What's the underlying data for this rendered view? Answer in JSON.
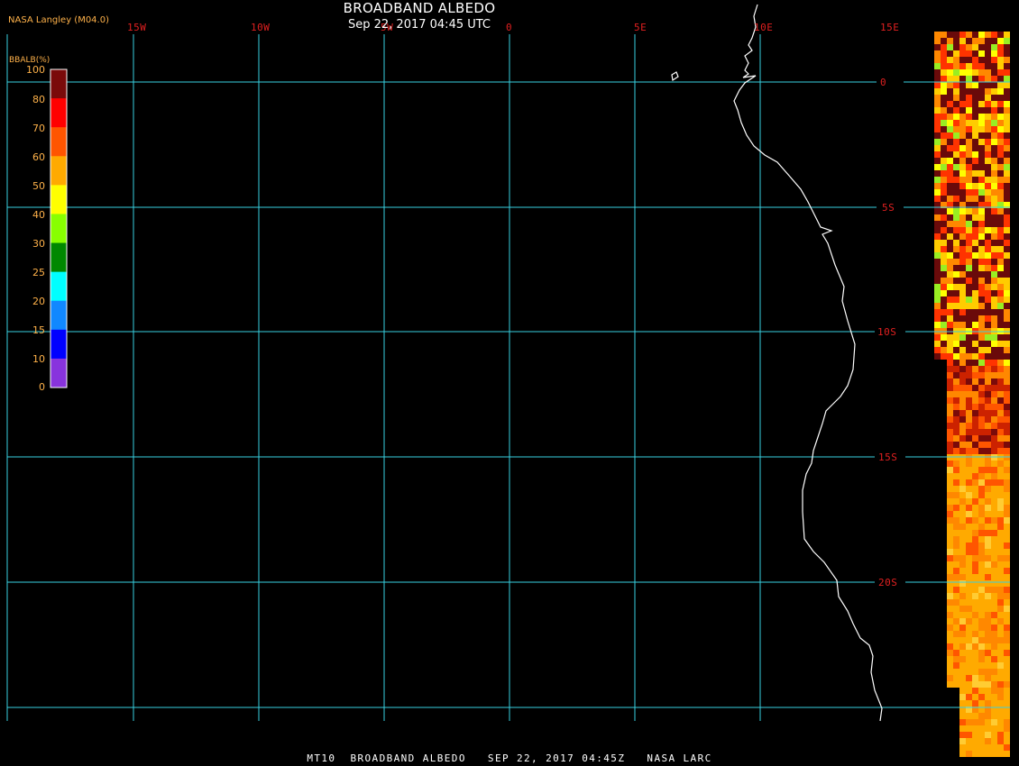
{
  "header": {
    "title": "BROADBAND ALBEDO",
    "subtitle": "Sep 22, 2017 04:45 UTC",
    "agency": "NASA Langley (M04.0)"
  },
  "footer": "MT10  BROADBAND ALBEDO   SEP 22, 2017 04:45Z   NASA LARC",
  "map": {
    "longitude_labels": [
      "15W",
      "10W",
      "5W",
      "0",
      "5E",
      "10E",
      "15E"
    ],
    "latitude_labels": [
      "0",
      "5S",
      "10S",
      "15S",
      "20S"
    ],
    "colors": {
      "background": "#000000",
      "gridlines": "#38d0e0",
      "coastline": "#ffffff",
      "grid_labels": "#e02020"
    }
  },
  "colorbar": {
    "title": "BBALB(%)",
    "ticks": [
      "100",
      "80",
      "70",
      "60",
      "50",
      "40",
      "30",
      "25",
      "20",
      "15",
      "10",
      "0"
    ],
    "colors": [
      "#7a0a0a",
      "#ff0000",
      "#ff5500",
      "#ffaa00",
      "#ffff00",
      "#88ff00",
      "#008800",
      "#00ffff",
      "#1188ff",
      "#0000ff",
      "#8833dd"
    ]
  }
}
